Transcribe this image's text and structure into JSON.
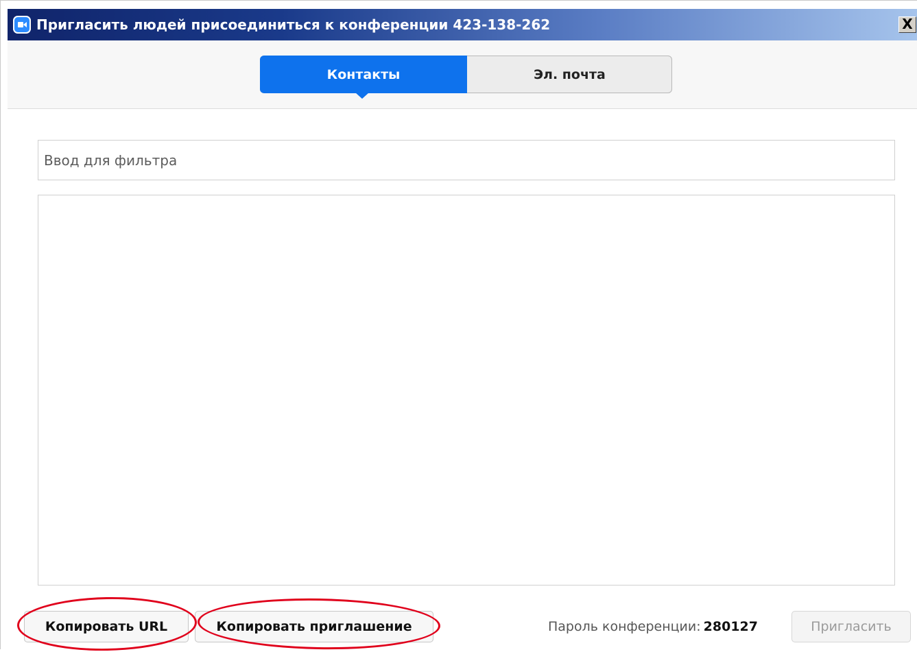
{
  "window": {
    "title": "Пригласить людей присоединиться к конференции 423-138-262",
    "close_label": "X",
    "app_icon": "zoom-camera-icon"
  },
  "tabs": [
    {
      "label": "Контакты",
      "active": true
    },
    {
      "label": "Эл. почта",
      "active": false
    }
  ],
  "filter": {
    "placeholder": "Ввод для фильтра",
    "value": ""
  },
  "contacts": [],
  "footer": {
    "copy_url_label": "Копировать URL",
    "copy_invitation_label": "Копировать приглашение",
    "password_label": "Пароль конференции:",
    "password_value": "280127",
    "invite_label": "Пригласить"
  },
  "colors": {
    "accent": "#0e72ed",
    "annotation": "#e0001b"
  }
}
